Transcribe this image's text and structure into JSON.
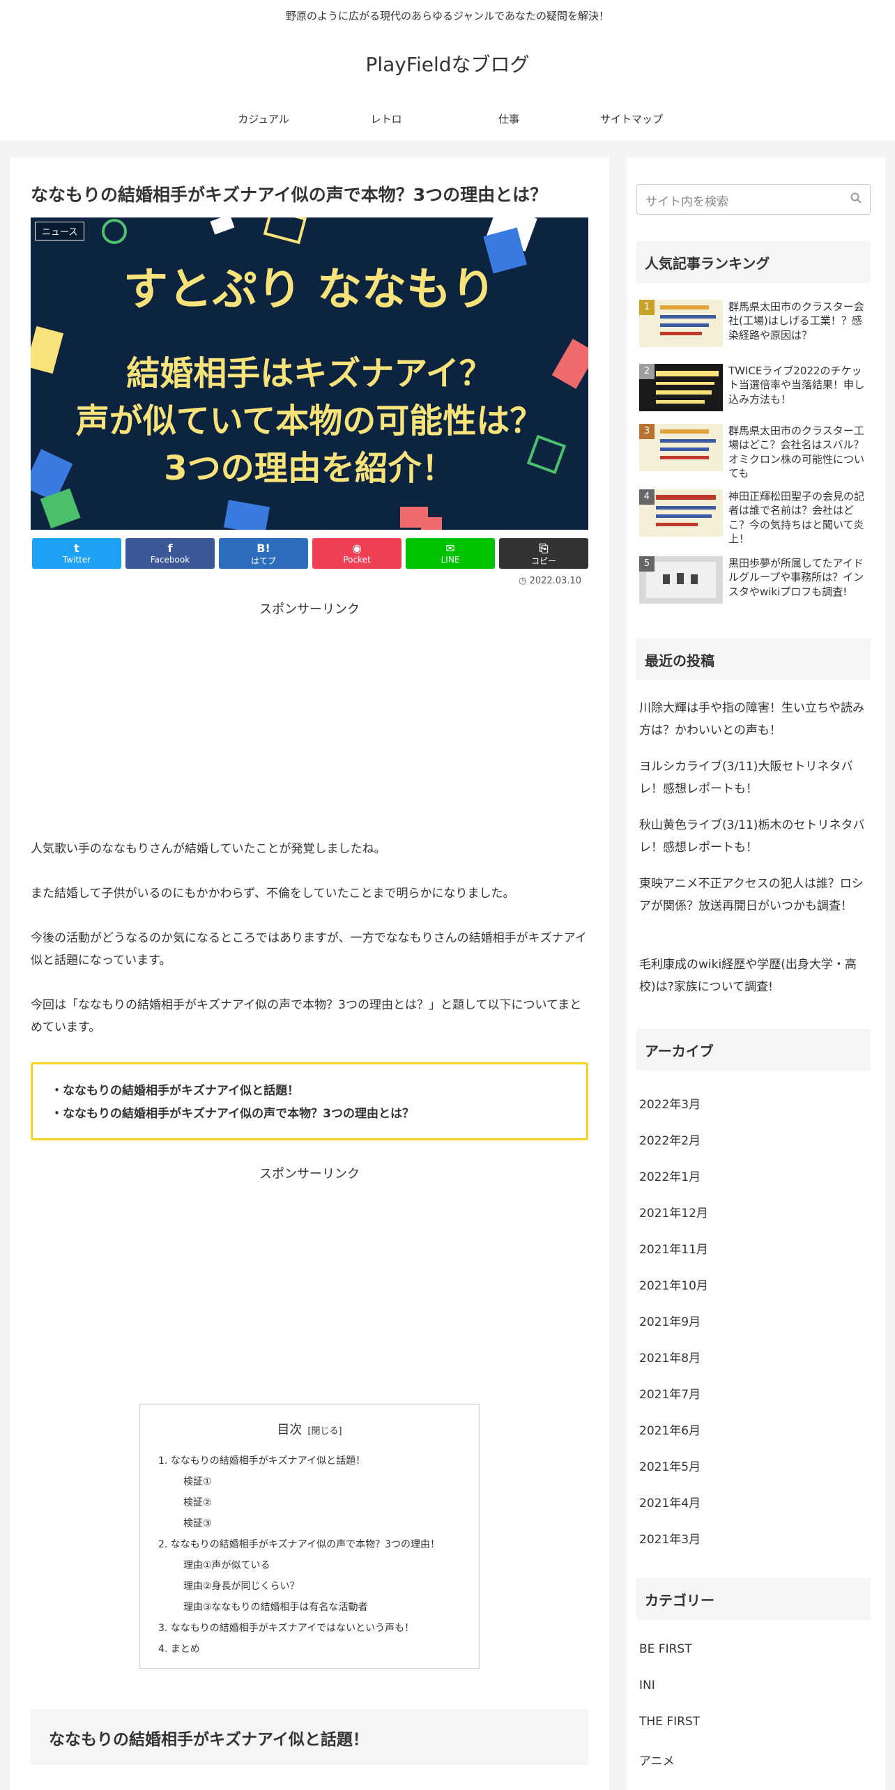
{
  "header": {
    "tagline": "野原のように広がる現代のあらゆるジャンルであなたの疑問を解決！",
    "site_title": "PlayFieldなブログ",
    "nav": [
      "カジュアル",
      "レトロ",
      "仕事",
      "サイトマップ"
    ]
  },
  "article": {
    "title": "ななもりの結婚相手がキズナアイ似の声で本物？3つの理由とは？",
    "eyecatch": {
      "category": "ニュース",
      "line1": "すとぷり ななもり",
      "line2": "結婚相手はキズナアイ？",
      "line3": "声が似ていて本物の可能性は？",
      "line4": "3つの理由を紹介！"
    },
    "share": [
      {
        "icon": "t",
        "label": "Twitter",
        "color": "#1da1f2"
      },
      {
        "icon": "f",
        "label": "Facebook",
        "color": "#3b5998"
      },
      {
        "icon": "B!",
        "label": "はてブ",
        "color": "#2c6ebd"
      },
      {
        "icon": "◉",
        "label": "Pocket",
        "color": "#ef4056"
      },
      {
        "icon": "✉",
        "label": "LINE",
        "color": "#00c300"
      },
      {
        "icon": "⎘",
        "label": "コピー",
        "color": "#333333"
      }
    ],
    "date": "2022.03.10",
    "sponsor": "スポンサーリンク",
    "paragraphs": [
      "人気歌い手のななもりさんが結婚していたことが発覚しましたね。",
      "また結婚して子供がいるのにもかかわらず、不倫をしていたことまで明らかになりました。",
      "今後の活動がどうなるのか気になるところではありますが、一方でななもりさんの結婚相手がキズナアイ似と話題になっています。",
      "今回は「ななもりの結婚相手がキズナアイ似の声で本物？3つの理由とは？」と題して以下についてまとめています。"
    ],
    "box": [
      "・ななもりの結婚相手がキズナアイ似と話題！",
      "・ななもりの結婚相手がキズナアイ似の声で本物？3つの理由とは？"
    ],
    "toc": {
      "title": "目次",
      "toggle": "[閉じる]",
      "items": [
        {
          "text": "1. ななもりの結婚相手がキズナアイ似と話題！",
          "sub": false
        },
        {
          "text": "検証①",
          "sub": true
        },
        {
          "text": "検証②",
          "sub": true
        },
        {
          "text": "検証③",
          "sub": true
        },
        {
          "text": "2. ななもりの結婚相手がキズナアイ似の声で本物？3つの理由！",
          "sub": false
        },
        {
          "text": "理由①声が似ている",
          "sub": true
        },
        {
          "text": "理由②身長が同じくらい？",
          "sub": true
        },
        {
          "text": "理由③ななもりの結婚相手は有名な活動者",
          "sub": true
        },
        {
          "text": "3. ななもりの結婚相手がキズナアイではないという声も！",
          "sub": false
        },
        {
          "text": "4. まとめ",
          "sub": false
        }
      ]
    },
    "h2": "ななもりの結婚相手がキズナアイ似と話題！"
  },
  "sidebar": {
    "search_placeholder": "サイト内を検索",
    "ranking_title": "人気記事ランキング",
    "ranking": [
      {
        "num": "1",
        "title": "群馬県太田市のクラスター会社(工場)はしげる工業！？感染経路や原因は？",
        "badge": "#c9a227",
        "thumb": "#f4efd6"
      },
      {
        "num": "2",
        "title": "TWICEライブ2022のチケット当選倍率や当落結果！申し込み方法も！",
        "badge": "#9e9e9e",
        "thumb": "#1a1a1a"
      },
      {
        "num": "3",
        "title": "群馬県太田市のクラスター工場はどこ？会社名はスバル？オミクロン株の可能性についても",
        "badge": "#b87333",
        "thumb": "#f4efd6"
      },
      {
        "num": "4",
        "title": "神田正輝松田聖子の会見の記者は誰で名前は？会社はどこ？今の気持ちはと聞いて炎上！",
        "badge": "#666666",
        "thumb": "#f4efd6"
      },
      {
        "num": "5",
        "title": "黒田歩夢が所属してたアイドルグループや事務所は？インスタやwikiプロフも調査!",
        "badge": "#666666",
        "thumb": "#d9d9d9"
      }
    ],
    "recent_title": "最近の投稿",
    "recent": [
      "川除大輝は手や指の障害！生い立ちや読み方は？かわいいとの声も！",
      "ヨルシカライブ(3/11)大阪セトリネタバレ！感想レポートも！",
      "秋山黄色ライブ(3/11)栃木のセトリネタバレ！感想レポートも！",
      "東映アニメ不正アクセスの犯人は誰？ロシアが関係？放送再開日がいつかも調査！",
      "毛利康成のwiki経歴や学歴(出身大学・高校)は?家族について調査!"
    ],
    "archive_title": "アーカイブ",
    "archive": [
      "2022年3月",
      "2022年2月",
      "2022年1月",
      "2021年12月",
      "2021年11月",
      "2021年10月",
      "2021年9月",
      "2021年8月",
      "2021年7月",
      "2021年6月",
      "2021年5月",
      "2021年4月",
      "2021年3月"
    ],
    "category_title": "カテゴリー",
    "categories": [
      "BE FIRST",
      "INI",
      "THE FIRST",
      "アニメ"
    ]
  }
}
